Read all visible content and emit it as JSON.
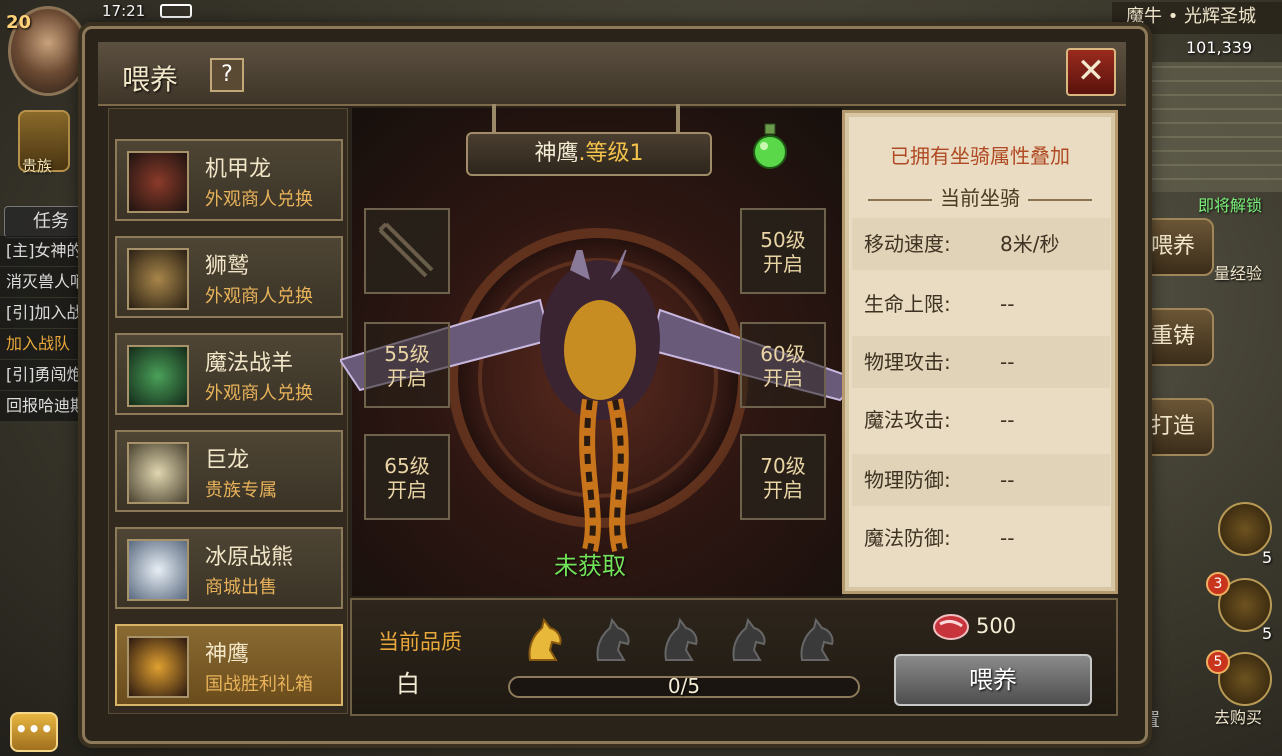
{
  "hud": {
    "player_level": "20",
    "clock": "17:21",
    "noble_label": "贵族",
    "quest_tab": "任务",
    "quest_items": [
      "[主]女神的",
      "消灭兽人哨",
      "[引]加入战",
      "加入战队",
      "[引]勇闯炮",
      "回报哈迪斯"
    ],
    "location": "魔牛 • 光辉圣城",
    "coin_count": "101,339",
    "unlock_soon": "即将解锁",
    "exp_label": "量经验",
    "side_buttons": [
      "喂养",
      "重铸",
      "打造"
    ],
    "round_counts": [
      "5",
      "5"
    ],
    "badges": [
      "3",
      "5"
    ],
    "buy_label": "去购买",
    "settings_label": "设置",
    "menu_label": "•••"
  },
  "panel": {
    "title": "喂养",
    "help_label": "?",
    "close_label": "✕",
    "mounts": [
      {
        "name": "机甲龙",
        "source": "外观商人兑换"
      },
      {
        "name": "狮鹫",
        "source": "外观商人兑换"
      },
      {
        "name": "魔法战羊",
        "source": "外观商人兑换"
      },
      {
        "name": "巨龙",
        "source": "贵族专属"
      },
      {
        "name": "冰原战熊",
        "source": "商城出售"
      },
      {
        "name": "神鹰",
        "source": "国战胜利礼箱"
      }
    ],
    "selected_mount": {
      "name": "神鹰",
      "level_suffix": ".等级1"
    },
    "slots": {
      "slot_50": "50级\n开启",
      "slot_55": "55级\n开启",
      "slot_60": "60级\n开启",
      "slot_65": "65级\n开启",
      "slot_70": "70级\n开启"
    },
    "status": "未获取",
    "stats": {
      "heading": "已拥有坐骑属性叠加",
      "subheading": "当前坐骑",
      "rows": [
        {
          "label": "移动速度:",
          "value": "8米/秒"
        },
        {
          "label": "生命上限:",
          "value": "--"
        },
        {
          "label": "物理攻击:",
          "value": "--"
        },
        {
          "label": "魔法攻击:",
          "value": "--"
        },
        {
          "label": "物理防御:",
          "value": "--"
        },
        {
          "label": "魔法防御:",
          "value": "--"
        }
      ]
    },
    "quality": {
      "label": "当前品质",
      "value": "白",
      "stars_filled": 1,
      "stars_total": 5
    },
    "progress": {
      "text": "0/5",
      "fraction": 0
    },
    "cost": "500",
    "feed_button": "喂养"
  },
  "colors": {
    "accent_gold": "#e8a83a",
    "status_green": "#72e25a",
    "stat_heading": "#b04a24"
  },
  "icons": [
    "help-icon",
    "close-icon",
    "potion-icon",
    "horse-icon",
    "meat-icon",
    "crossbow-icon"
  ]
}
